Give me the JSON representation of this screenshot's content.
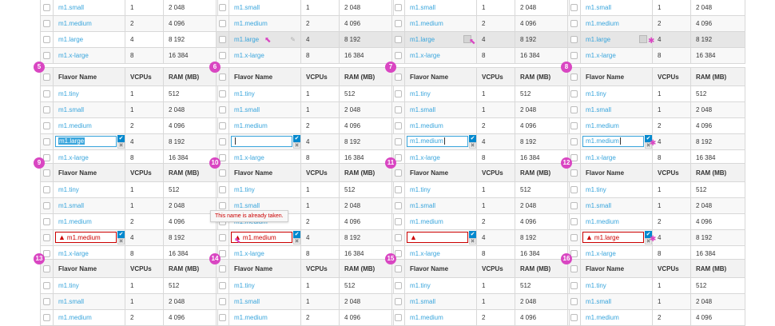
{
  "headers": {
    "name": "Flavor Name",
    "vcpus": "VCPUs",
    "ram": "RAM (MB)"
  },
  "rows": {
    "tiny": {
      "name": "m1.tiny",
      "vcpus": "1",
      "ram": "512"
    },
    "small": {
      "name": "m1.small",
      "vcpus": "1",
      "ram": "2 048"
    },
    "medium": {
      "name": "m1.medium",
      "vcpus": "2",
      "ram": "4 096"
    },
    "large": {
      "name": "m1.large",
      "vcpus": "4",
      "ram": "8 192"
    },
    "xlarge": {
      "name": "m1.x-large",
      "vcpus": "8",
      "ram": "16 384"
    }
  },
  "steps": [
    "5",
    "6",
    "7",
    "8",
    "9",
    "10",
    "11",
    "12",
    "13",
    "14",
    "15",
    "16"
  ],
  "edit_values": {
    "s7": "m1.medium",
    "s8": "m1.medium",
    "s9": "m1.medium",
    "s10": "m1.medium",
    "s12": "m1.large"
  },
  "tooltip": "This name is already taken.",
  "icons": {
    "confirm": "checkmark-icon",
    "cancel": "close-icon",
    "warning": "warning-triangle-icon",
    "edit": "pencil-icon",
    "cursor": "pointer-cursor-icon"
  },
  "colors": {
    "accent": "#39a5dc",
    "confirm": "#0088ce",
    "error": "#cc0000",
    "step_badge": "#d946c2",
    "row_hover": "#e6e6e6"
  }
}
